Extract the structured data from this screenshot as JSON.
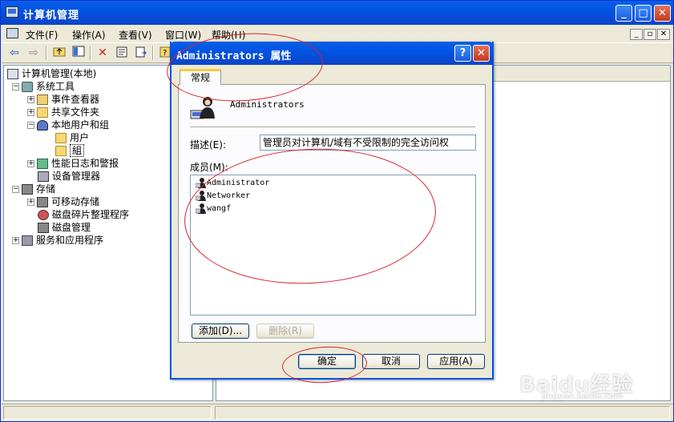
{
  "window": {
    "title": "计算机管理",
    "minimize": "_",
    "maximize": "□",
    "close": "✕"
  },
  "menu": {
    "items": [
      "文件(F)",
      "操作(A)",
      "查看(V)",
      "窗口(W)",
      "帮助(H)"
    ],
    "mdi": [
      "_",
      "▫",
      "✕"
    ]
  },
  "toolbar": {
    "back": "⇦",
    "forward": "⇨",
    "delete": "✕"
  },
  "tree": {
    "root": "计算机管理(本地)",
    "system_tools": "系统工具",
    "event_viewer": "事件查看器",
    "shared_folders": "共享文件夹",
    "local_users_groups": "本地用户和组",
    "users": "用户",
    "groups": "組",
    "perf_logs": "性能日志和警报",
    "device_manager": "设备管理器",
    "storage": "存储",
    "removable_storage": "可移动存储",
    "defrag": "磁盘碎片整理程序",
    "disk_management": "磁盘管理",
    "services_apps": "服务和应用程序",
    "expand": "+",
    "collapse": "−"
  },
  "dialog": {
    "title": "Administrators 属性",
    "help": "?",
    "close": "✕",
    "tab": "常规",
    "group_name": "Administrators",
    "description_label": "描述(E):",
    "description_value": "管理员对计算机/域有不受限制的完全访问权",
    "members_label": "成员(M):",
    "members": [
      "Administrator",
      "Networker",
      "wangf"
    ],
    "add_button": "添加(D)...",
    "remove_button": "删除(R)",
    "ok_button": "确定",
    "cancel_button": "取消",
    "apply_button": "应用(A)"
  },
  "watermark": {
    "brand": "Baidu经验",
    "url": "jingyan.baidu.com"
  }
}
